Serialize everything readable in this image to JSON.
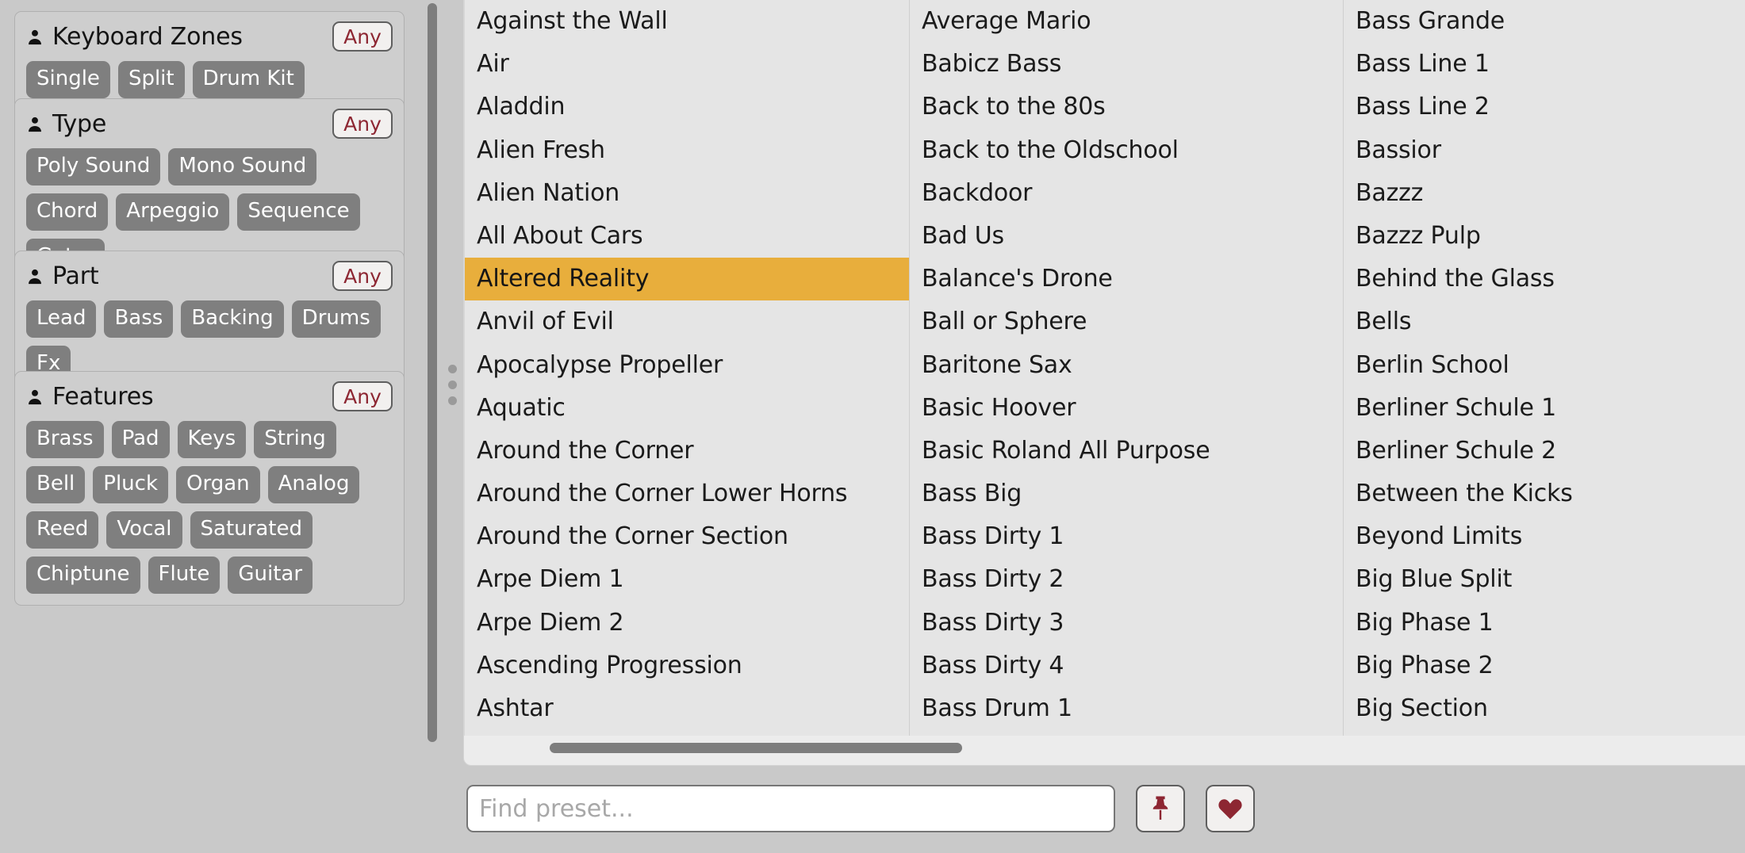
{
  "sidebar": {
    "groups": [
      {
        "title": "Keyboard Zones",
        "icon": "person-icon",
        "any_label": "Any",
        "tags": [
          "Single",
          "Split",
          "Drum Kit"
        ]
      },
      {
        "title": "Type",
        "icon": "person-icon",
        "any_label": "Any",
        "tags": [
          "Poly Sound",
          "Mono Sound",
          "Chord",
          "Arpeggio",
          "Sequence",
          "Gater"
        ]
      },
      {
        "title": "Part",
        "icon": "person-icon",
        "any_label": "Any",
        "tags": [
          "Lead",
          "Bass",
          "Backing",
          "Drums",
          "Fx"
        ]
      },
      {
        "title": "Features",
        "icon": "person-icon",
        "any_label": "Any",
        "tags": [
          "Brass",
          "Pad",
          "Keys",
          "String",
          "Bell",
          "Pluck",
          "Organ",
          "Analog",
          "Reed",
          "Vocal",
          "Saturated",
          "Chiptune",
          "Flute",
          "Guitar"
        ]
      }
    ]
  },
  "splitter": {
    "icon": "drag-handle-dots-icon"
  },
  "preset_list": {
    "selected": "Altered Reality",
    "columns": [
      {
        "items": [
          "Against the Wall",
          "Air",
          "Aladdin",
          "Alien Fresh",
          "Alien Nation",
          "All About Cars",
          "Altered Reality",
          "Anvil of Evil",
          "Apocalypse Propeller",
          "Aquatic",
          "Around the Corner",
          "Around the Corner Lower Horns",
          "Around the Corner Section",
          "Arpe Diem 1",
          "Arpe Diem 2",
          "Ascending Progression",
          "Ashtar"
        ]
      },
      {
        "items": [
          "Average Mario",
          "Babicz Bass",
          "Back to the 80s",
          "Back to the Oldschool",
          "Backdoor",
          "Bad Us",
          "Balance's Drone",
          "Ball or Sphere",
          "Baritone Sax",
          "Basic Hoover",
          "Basic Roland All Purpose",
          "Bass Big",
          "Bass Dirty 1",
          "Bass Dirty 2",
          "Bass Dirty 3",
          "Bass Dirty 4",
          "Bass Drum 1"
        ]
      },
      {
        "items": [
          "Bass Grande",
          "Bass Line 1",
          "Bass Line 2",
          "Bassior",
          "Bazzz",
          "Bazzz Pulp",
          "Behind the Glass",
          "Bells",
          "Berlin School",
          "Berliner Schule 1",
          "Berliner Schule 2",
          "Between the Kicks",
          "Beyond Limits",
          "Big Blue Split",
          "Big Phase 1",
          "Big Phase 2",
          "Big Section"
        ]
      }
    ]
  },
  "bottom_bar": {
    "search_placeholder": "Find preset...",
    "search_value": "",
    "pin_button_icon": "pin-icon",
    "favorite_button_icon": "heart-icon"
  },
  "colors": {
    "selection": "#e8ae3c",
    "accent_red": "#8d2632",
    "tag_bg": "#7f7f7f",
    "panel_bg": "#c9c9c9",
    "list_bg": "#e5e5e5",
    "scrollbar": "#7d7d7d"
  }
}
